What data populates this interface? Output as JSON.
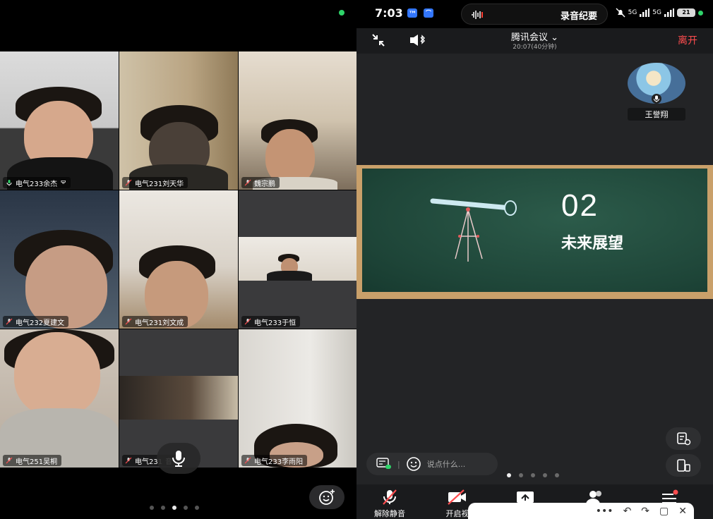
{
  "participants": [
    {
      "name": "电气233余杰",
      "extra": "ᄝ"
    },
    {
      "name": "电气231刘天华",
      "extra": ""
    },
    {
      "name": "魏宗鹏",
      "extra": ""
    },
    {
      "name": "电气232夏建文",
      "extra": ""
    },
    {
      "name": "电气231刘文成",
      "extra": ""
    },
    {
      "name": "电气233于恒",
      "extra": ""
    },
    {
      "name": "电气251吴桐",
      "extra": ""
    },
    {
      "name": "电气231",
      "extra": "音"
    },
    {
      "name": "电气233李雨阳",
      "extra": ""
    }
  ],
  "status_bar": {
    "time": "7:03",
    "recording_label": "录音纪要",
    "battery": "21",
    "network_a": "5G",
    "network_b": "5G"
  },
  "meeting": {
    "title": "腾讯会议",
    "subtitle": "20:07(40分钟)",
    "leave_label": "离开"
  },
  "host": {
    "name": "王誉翔"
  },
  "slide": {
    "number": "02",
    "title": "未来展望"
  },
  "chat": {
    "placeholder": "说点什么..."
  },
  "bottom_bar": {
    "unmute_label": "解除静音",
    "video_label": "开启视"
  },
  "colors": {
    "active_speaker": "#2fbf5a",
    "leave": "#ff4d4f",
    "slide_bg": "#1e4538",
    "slide_frame": "#c9a06a"
  }
}
